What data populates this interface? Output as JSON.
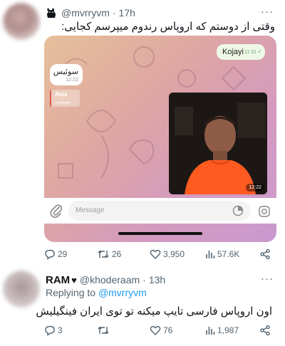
{
  "tweet1": {
    "handle": "@mvrryvm",
    "separator": "·",
    "time": "17h",
    "more": "···",
    "text": "وقتی از دوستم که اروپاس رندوم میپرسم کجایی:",
    "media": {
      "kojayi": {
        "text": "Kojayi",
        "time": "11:31"
      },
      "swiss": {
        "text": "سوئیس",
        "time": "12:22"
      },
      "reply": {
        "name": "Anis",
        "text": "سوئیس"
      },
      "video_time": "12:22",
      "input_placeholder": "Message"
    },
    "actions": {
      "replies": "29",
      "retweets": "26",
      "likes": "3,950",
      "views": "57.6K"
    }
  },
  "tweet2": {
    "name": "RAM",
    "heart_emoji": "♥",
    "handle": "@khoderaam",
    "separator": "·",
    "time": "13h",
    "more": "···",
    "replying_prefix": "Replying to",
    "replying_to": "@mvrryvm",
    "text": "اون اروپاس فارسی تایپ میکنه تو توی ایران فینگیلیش",
    "actions": {
      "replies": "3",
      "retweets": "",
      "likes": "76",
      "views": "1,987"
    }
  },
  "colors": {
    "link": "#1d9bf0",
    "muted": "#536471",
    "text": "#0f1419"
  }
}
